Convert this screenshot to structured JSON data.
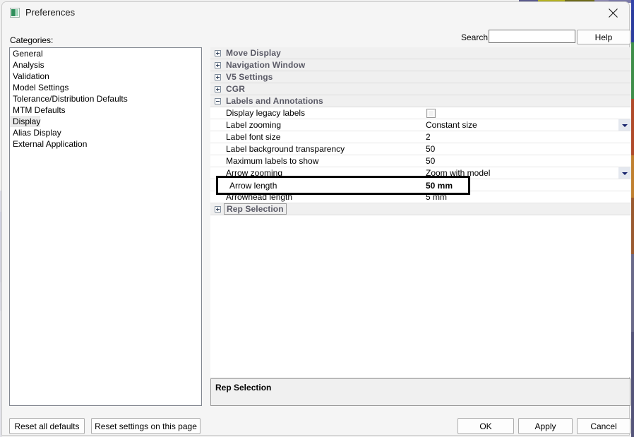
{
  "window": {
    "title": "Preferences",
    "icon": "app-icon",
    "close_icon": "close-icon"
  },
  "labels": {
    "categories": "Categories:",
    "search": "Search:"
  },
  "search": {
    "value": "",
    "placeholder": ""
  },
  "help_button": "Help",
  "categories": {
    "items": [
      {
        "label": "General",
        "selected": false
      },
      {
        "label": "Analysis",
        "selected": false
      },
      {
        "label": "Validation",
        "selected": false
      },
      {
        "label": "Model Settings",
        "selected": false
      },
      {
        "label": "Tolerance/Distribution Defaults",
        "selected": false
      },
      {
        "label": "MTM Defaults",
        "selected": false
      },
      {
        "label": "Display",
        "selected": true
      },
      {
        "label": "Alias Display",
        "selected": false
      },
      {
        "label": "External Application",
        "selected": false
      }
    ]
  },
  "property_grid": {
    "rows": [
      {
        "type": "group",
        "name": "Move Display",
        "expanded": false,
        "value": "",
        "control": "none"
      },
      {
        "type": "group",
        "name": "Navigation Window",
        "expanded": false,
        "value": "",
        "control": "none"
      },
      {
        "type": "group",
        "name": "V5 Settings",
        "expanded": false,
        "value": "",
        "control": "none"
      },
      {
        "type": "group",
        "name": "CGR",
        "expanded": false,
        "value": "",
        "control": "none"
      },
      {
        "type": "group",
        "name": "Labels and Annotations",
        "expanded": true,
        "value": "",
        "control": "none"
      },
      {
        "type": "prop",
        "name": "Display legacy labels",
        "value": "",
        "control": "checkbox",
        "checked": false
      },
      {
        "type": "prop",
        "name": "Label zooming",
        "value": "Constant size",
        "control": "combo"
      },
      {
        "type": "prop",
        "name": "Label font size",
        "value": "2",
        "control": "text"
      },
      {
        "type": "prop",
        "name": "Label background transparency",
        "value": "50",
        "control": "text"
      },
      {
        "type": "prop",
        "name": "Maximum labels to show",
        "value": "50",
        "control": "text"
      },
      {
        "type": "prop",
        "name": "Arrow zooming",
        "value": "Zoom with model",
        "control": "combo"
      },
      {
        "type": "prop",
        "name": "Arrow length",
        "value": "50 mm",
        "control": "text",
        "bold_value": true,
        "highlighted": true
      },
      {
        "type": "prop",
        "name": "Arrowhead length",
        "value": "5 mm",
        "control": "text"
      },
      {
        "type": "group",
        "name": "Rep Selection",
        "expanded": false,
        "value": "",
        "control": "none",
        "selected": true
      }
    ]
  },
  "highlight": {
    "name": "Arrow length",
    "value": "50 mm",
    "color": "#000000"
  },
  "description_pane": {
    "title": "Rep Selection"
  },
  "footer": {
    "reset_all_defaults": "Reset all defaults",
    "reset_settings_on_this_page": "Reset settings on this page",
    "ok": "OK",
    "apply": "Apply",
    "cancel": "Cancel"
  }
}
